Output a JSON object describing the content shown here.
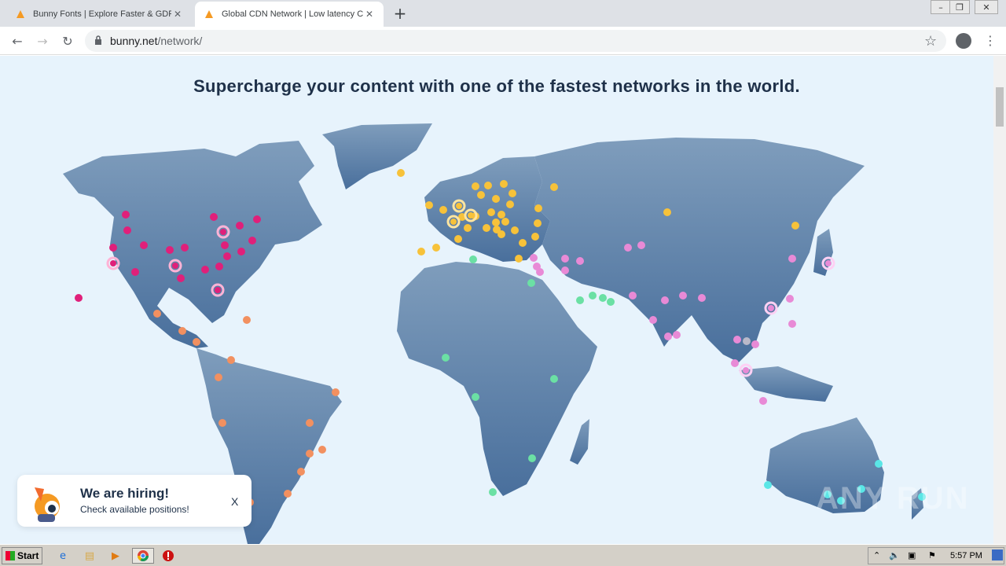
{
  "browser": {
    "tabs": [
      {
        "title": "Bunny Fonts | Explore Faster & GDPR",
        "active": false
      },
      {
        "title": "Global CDN Network | Low latency CDN",
        "active": true
      }
    ],
    "address": {
      "host": "bunny.net",
      "path": "/network/"
    }
  },
  "page": {
    "headline": "Supercharge your content with one of the fastest networks in the world.",
    "hiring": {
      "title": "We are hiring!",
      "subtitle": "Check available positions!",
      "close": "X"
    },
    "watermark": "ANY RUN",
    "region_colors": {
      "north_america": "#e0207a",
      "south_america": "#f29060",
      "europe": "#f7c23a",
      "africa_middle_east": "#6be0a4",
      "asia": "#e88ad6",
      "oceania": "#5ae6e6"
    }
  },
  "taskbar": {
    "start_label": "Start",
    "clock": "5:57 PM"
  }
}
